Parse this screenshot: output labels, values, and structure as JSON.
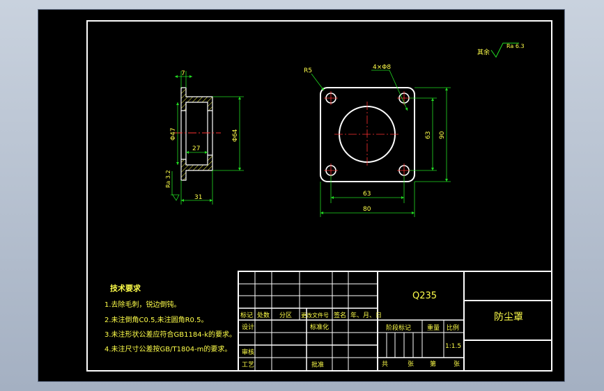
{
  "colors": {
    "background": "#000000",
    "frame": "#ffffff",
    "dimension": "#22dd22",
    "centerline": "#ff3030",
    "hatch": "#ffff4a",
    "text": "#ffff4a"
  },
  "roughness_note": {
    "prefix": "其余",
    "value": "Ra 6.3"
  },
  "section_view": {
    "dims": {
      "top_width": "7",
      "inner_dia": "Φ47",
      "outer_dia": "Φ64",
      "inner_depth": "27",
      "total_length": "31",
      "roughness": "Ra 3.2"
    }
  },
  "plan_view": {
    "dims": {
      "corner_radius": "R5",
      "holes": "4×Φ8",
      "hole_spacing_v": "63",
      "outer_v": "90",
      "hole_spacing_h": "63",
      "outer_h": "80"
    }
  },
  "tech_requirements": {
    "title": "技术要求",
    "items": [
      "1.去除毛刺，锐边倒钝。",
      "2.未注倒角C0.5,未注圆角R0.5。",
      "3.未注形状公差应符合GB1184-k的要求。",
      "4.未注尺寸公差按GB/T1804-m的要求。"
    ]
  },
  "title_block": {
    "material": "Q235",
    "part_name": "防尘罩",
    "header_labels": [
      "标记",
      "处数",
      "分区",
      "更改文件号",
      "签名",
      "年、月、日"
    ],
    "design_label": "设计",
    "standardization_label": "标准化",
    "review_label": "审核",
    "process_label": "工艺",
    "approve_label": "批准",
    "stage_label": "阶段标记",
    "weight_label": "重量",
    "scale_label": "比例",
    "scale_value": "1:1.5",
    "sheets_total": "共",
    "sheets_unit1": "张",
    "sheet_no": "第",
    "sheets_unit2": "张"
  }
}
